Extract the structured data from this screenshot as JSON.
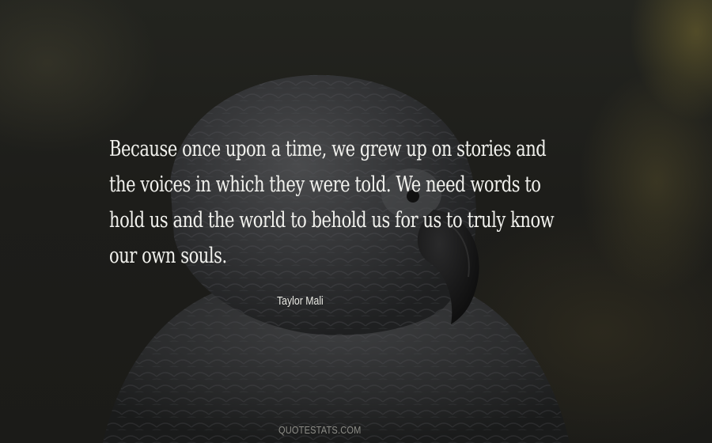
{
  "quote": {
    "lines": [
      "Because once upon a time, we grew up on stories and",
      "the voices in which they were told. We need words to",
      "hold us and the world to behold us for us to truly know",
      "our own souls."
    ]
  },
  "author": "Taylor Mali",
  "watermark": "QUOTESTATS.COM",
  "background": {
    "subject": "parrot-illustration",
    "base_color": "#1b1b18",
    "bird_color": "#3a3b3c",
    "accent_color": "#a8963c"
  }
}
